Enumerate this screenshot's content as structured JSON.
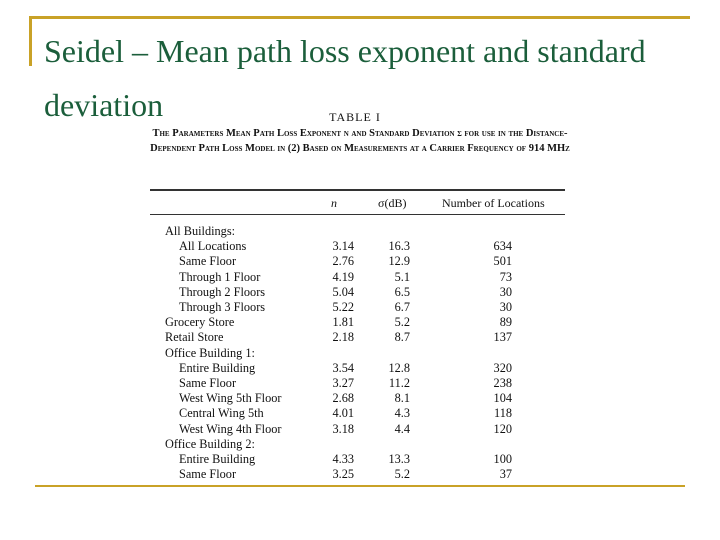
{
  "slide": {
    "title": "Seidel – Mean path loss exponent and standard deviation",
    "accent_color": "#c9a227",
    "title_color": "#1b5e3b"
  },
  "table": {
    "label": "TABLE I",
    "caption": "The Parameters Mean Path Loss Exponent n and Standard Deviation σ for use in the Distance-Dependent Path Loss Model in (2) Based on Measurements at a Carrier Frequency of 914 MHz",
    "headers": {
      "n": "n",
      "sigma": "σ(dB)",
      "locations": "Number of Locations"
    },
    "rows": [
      {
        "label": "All Buildings:",
        "group": true
      },
      {
        "label": "All Locations",
        "n": "3.14",
        "sigma": "16.3",
        "locations": "634"
      },
      {
        "label": "Same Floor",
        "n": "2.76",
        "sigma": "12.9",
        "locations": "501"
      },
      {
        "label": "Through 1 Floor",
        "n": "4.19",
        "sigma": "5.1",
        "locations": "73"
      },
      {
        "label": "Through 2 Floors",
        "n": "5.04",
        "sigma": "6.5",
        "locations": "30"
      },
      {
        "label": "Through 3 Floors",
        "n": "5.22",
        "sigma": "6.7",
        "locations": "30"
      },
      {
        "label": "Grocery Store",
        "n": "1.81",
        "sigma": "5.2",
        "locations": "89",
        "top": true
      },
      {
        "label": "Retail Store",
        "n": "2.18",
        "sigma": "8.7",
        "locations": "137",
        "top": true
      },
      {
        "label": "Office Building 1:",
        "group": true
      },
      {
        "label": "Entire Building",
        "n": "3.54",
        "sigma": "12.8",
        "locations": "320"
      },
      {
        "label": "Same Floor",
        "n": "3.27",
        "sigma": "11.2",
        "locations": "238"
      },
      {
        "label": "West Wing 5th Floor",
        "n": "2.68",
        "sigma": "8.1",
        "locations": "104"
      },
      {
        "label": "Central Wing 5th",
        "n": "4.01",
        "sigma": "4.3",
        "locations": "118"
      },
      {
        "label": "West Wing 4th Floor",
        "n": "3.18",
        "sigma": "4.4",
        "locations": "120"
      },
      {
        "label": "Office Building 2:",
        "group": true
      },
      {
        "label": "Entire Building",
        "n": "4.33",
        "sigma": "13.3",
        "locations": "100"
      },
      {
        "label": "Same Floor",
        "n": "3.25",
        "sigma": "5.2",
        "locations": "37"
      }
    ]
  }
}
